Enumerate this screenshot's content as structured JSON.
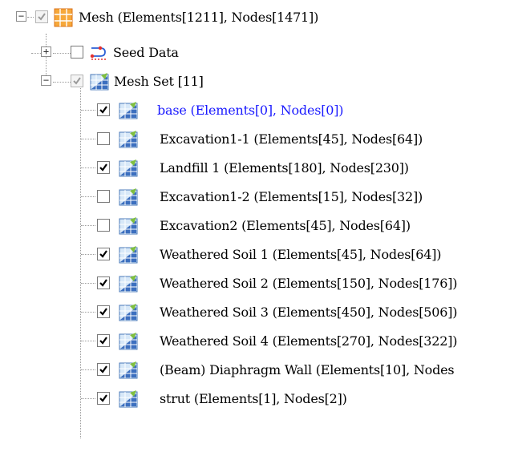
{
  "tree": {
    "mesh_label": "Mesh (Elements[1211], Nodes[1471])",
    "seed_label": "Seed Data",
    "meshset_label": "Mesh Set [11]",
    "items": [
      {
        "label": "base (Elements[0], Nodes[0])",
        "checked": true,
        "selected": true
      },
      {
        "label": "Excavation1-1 (Elements[45], Nodes[64])",
        "checked": false,
        "selected": false
      },
      {
        "label": "Landfill 1 (Elements[180], Nodes[230])",
        "checked": true,
        "selected": false
      },
      {
        "label": "Excavation1-2 (Elements[15], Nodes[32])",
        "checked": false,
        "selected": false
      },
      {
        "label": "Excavation2 (Elements[45], Nodes[64])",
        "checked": false,
        "selected": false
      },
      {
        "label": "Weathered Soil 1 (Elements[45], Nodes[64])",
        "checked": true,
        "selected": false
      },
      {
        "label": "Weathered Soil 2 (Elements[150], Nodes[176])",
        "checked": true,
        "selected": false
      },
      {
        "label": "Weathered Soil 3 (Elements[450], Nodes[506])",
        "checked": true,
        "selected": false
      },
      {
        "label": "Weathered Soil 4 (Elements[270], Nodes[322])",
        "checked": true,
        "selected": false
      },
      {
        "label": "(Beam) Diaphragm Wall (Elements[10], Nodes",
        "checked": true,
        "selected": false
      },
      {
        "label": "strut (Elements[1], Nodes[2])",
        "checked": true,
        "selected": false
      }
    ],
    "expanders": {
      "collapsed": "+",
      "expanded": "−"
    },
    "colors": {
      "selected_text": "#1a1aff",
      "checkmark": "#000000"
    }
  }
}
